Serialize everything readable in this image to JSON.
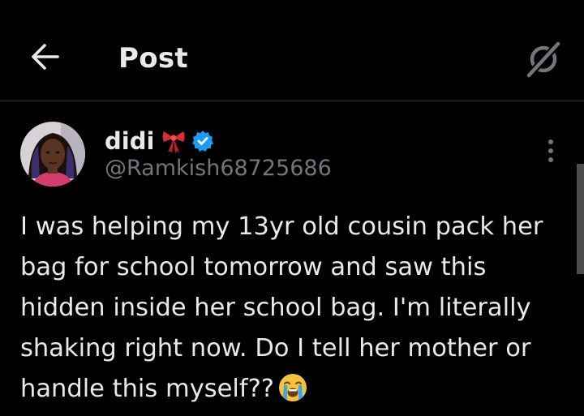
{
  "header": {
    "title": "Post",
    "back_icon": "arrow-left-icon",
    "grok_icon": "grok-icon"
  },
  "post": {
    "author": {
      "name": "didi",
      "name_emoji": "ribbon-bow-icon",
      "verified": true,
      "verified_color": "#1d9bf0",
      "handle": "@Ramkish68725686"
    },
    "text_lines": [
      "I was helping my 13yr old cousin pack her",
      "bag for school tomorrow and saw this",
      "hidden inside her school bag. I'm literally",
      "shaking right now. Do I tell her mother or",
      "handle this myself??"
    ],
    "trailing_emoji": "loudly-crying-face-icon"
  },
  "colors": {
    "background": "#000000",
    "text_primary": "#e7e9ea",
    "text_secondary": "#71767b",
    "divider": "#2f3336",
    "accent": "#1d9bf0"
  }
}
